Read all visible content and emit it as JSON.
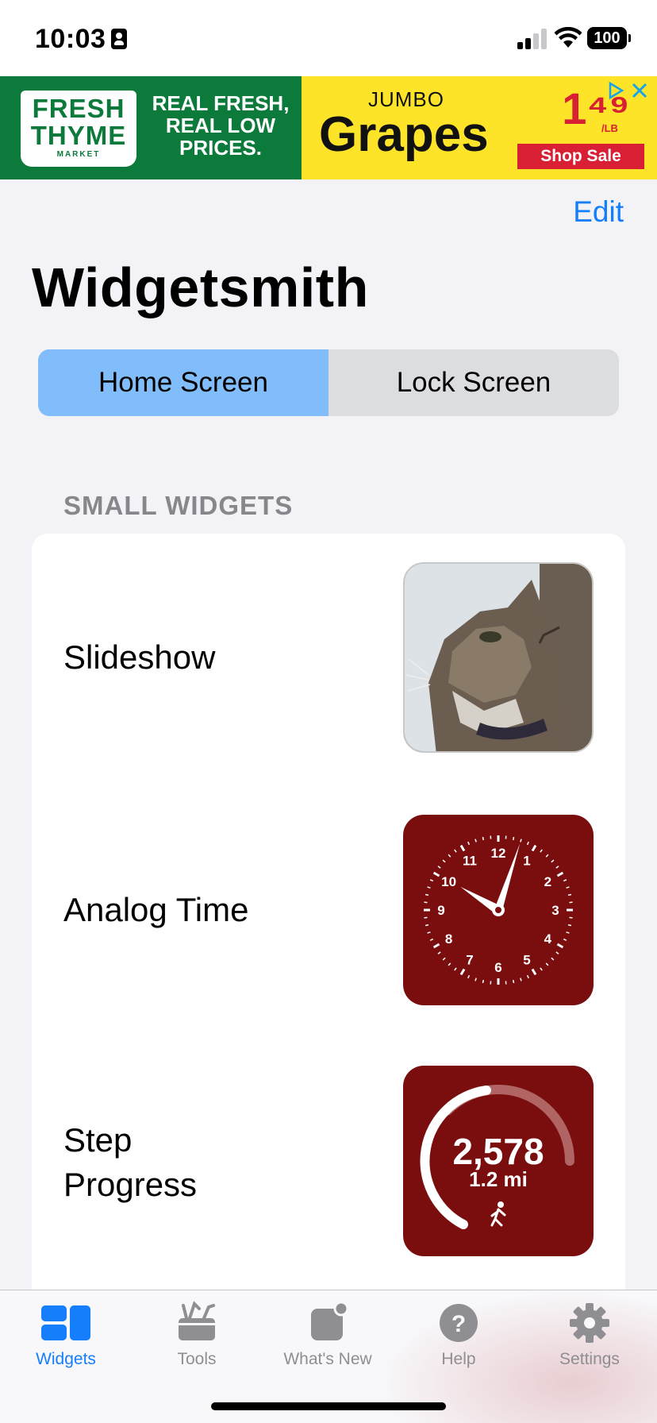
{
  "status_bar": {
    "time": "10:03",
    "battery": "100"
  },
  "ad": {
    "logo_line1": "FRESH",
    "logo_line2": "THYME",
    "logo_line3": "MARKET",
    "tagline": "REAL FRESH, REAL LOW PRICES.",
    "product_top": "JUMBO",
    "product_name": "Grapes",
    "price": "1⁴⁹",
    "price_unit": "/LB",
    "cta": "Shop Sale",
    "brand_green": "#0b7a3a",
    "brand_yellow": "#fde428",
    "brand_red": "#d81f34"
  },
  "header": {
    "edit_label": "Edit",
    "title": "Widgetsmith"
  },
  "segmented": {
    "home_label": "Home Screen",
    "lock_label": "Lock Screen",
    "selected": "Home Screen"
  },
  "section": {
    "header": "SMALL WIDGETS",
    "widgets": [
      {
        "label": "Slideshow",
        "preview": "cat-photo"
      },
      {
        "label": "Analog Time",
        "preview": "analog-clock"
      },
      {
        "label_line1": "Step",
        "label_line2": "Progress",
        "preview": "step-progress",
        "steps": "2,578",
        "distance": "1.2 mi"
      }
    ]
  },
  "clock": {
    "numbers": [
      "12",
      "1",
      "2",
      "3",
      "4",
      "5",
      "6",
      "7",
      "8",
      "9",
      "10",
      "11"
    ],
    "hour": 10,
    "minute": 3
  },
  "tab_bar": {
    "tabs": [
      {
        "label": "Widgets",
        "icon": "widgets-icon"
      },
      {
        "label": "Tools",
        "icon": "toolbox-icon"
      },
      {
        "label": "What's New",
        "icon": "notification-icon"
      },
      {
        "label": "Help",
        "icon": "help-icon"
      },
      {
        "label": "Settings",
        "icon": "gear-icon"
      }
    ],
    "active": "Widgets",
    "accent": "#147efb"
  }
}
